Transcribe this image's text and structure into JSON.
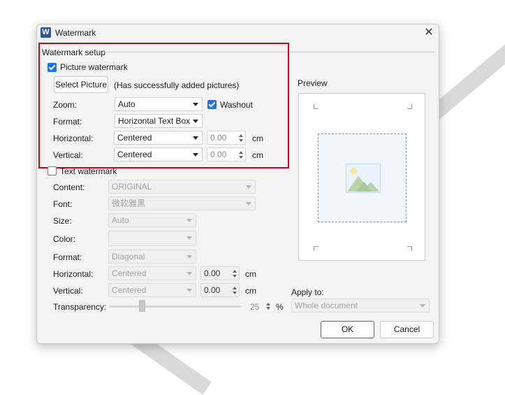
{
  "dialog": {
    "title": "Watermark",
    "app_icon_letter": "W",
    "close_glyph": "✕"
  },
  "picture_section": {
    "group_title": "Watermark setup",
    "picture_watermark_label": "Picture watermark",
    "picture_watermark_checked": true,
    "select_picture_label": "Select Picture",
    "status_text": "(Has successfully added pictures)",
    "zoom_label": "Zoom:",
    "zoom_value": "Auto",
    "washout_label": "Washout",
    "washout_checked": true,
    "format_label": "Format:",
    "format_value": "Horizontal Text Box",
    "horizontal_label": "Horizontal:",
    "horizontal_value": "Centered",
    "horizontal_offset": "0.00",
    "horizontal_unit": "cm",
    "vertical_label": "Vertical:",
    "vertical_value": "Centered",
    "vertical_offset": "0.00",
    "vertical_unit": "cm"
  },
  "text_section": {
    "text_watermark_label": "Text watermark",
    "text_watermark_checked": false,
    "content_label": "Content:",
    "content_value": "ORIGINAL",
    "font_label": "Font:",
    "font_value": "微软雅黑",
    "size_label": "Size:",
    "size_value": "Auto",
    "color_label": "Color:",
    "format_label": "Format:",
    "format_value": "Diagonal",
    "horizontal_label": "Horizontal:",
    "horizontal_value": "Centered",
    "horizontal_offset": "0.00",
    "horizontal_unit": "cm",
    "vertical_label": "Vertical:",
    "vertical_value": "Centered",
    "vertical_offset": "0.00",
    "vertical_unit": "cm",
    "transparency_label": "Transparency:",
    "transparency_value": "25",
    "transparency_unit": "%"
  },
  "preview": {
    "label": "Preview",
    "thumbnail_icon": "image-icon"
  },
  "apply": {
    "label": "Apply to:",
    "value": "Whole document"
  },
  "footer": {
    "ok_label": "OK",
    "cancel_label": "Cancel"
  },
  "colors": {
    "accent": "#1a73e8",
    "highlight_box": "#d0021b",
    "app_icon": "#2b579a"
  }
}
